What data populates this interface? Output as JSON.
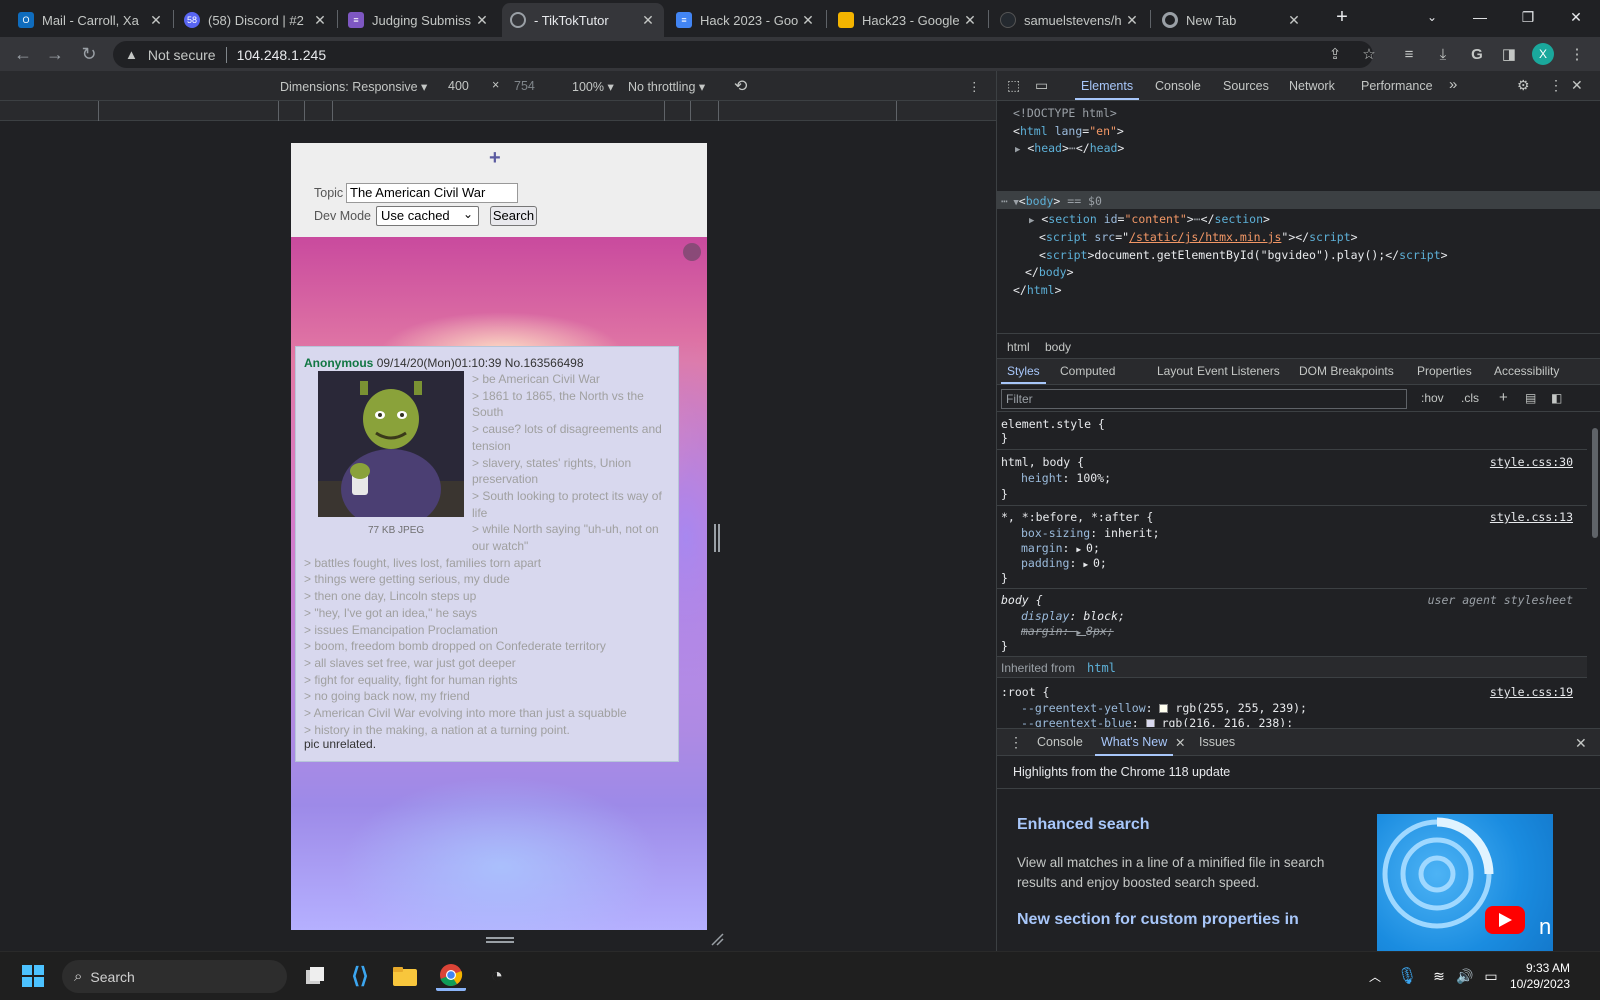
{
  "browser": {
    "tabs": [
      {
        "title": "Mail - Carroll, Xa",
        "color": "#0f6cbd",
        "icon": "outlook-icon"
      },
      {
        "title": "(58) Discord | #2",
        "color": "#5865f2",
        "icon": "discord-icon"
      },
      {
        "title": "Judging Submiss",
        "color": "#7e57c2",
        "icon": "forms-icon"
      },
      {
        "title": "- TikTokTutor",
        "color": "#9aa0a6",
        "icon": "globe-icon"
      },
      {
        "title": "Hack 2023 - Goo",
        "color": "#4285f4",
        "icon": "google-docs-icon"
      },
      {
        "title": "Hack23 - Google",
        "color": "#f4b400",
        "icon": "google-slides-icon"
      },
      {
        "title": "samuelstevens/h",
        "color": "#24292f",
        "icon": "github-icon"
      },
      {
        "title": "New Tab",
        "color": "#9aa0a6",
        "icon": "chrome-icon"
      }
    ],
    "security_label": "Not secure",
    "url": "104.248.1.245",
    "profile_initial": "X"
  },
  "device_toolbar": {
    "dimensions": "Dimensions: Responsive",
    "width": "400",
    "times": "×",
    "height": "754",
    "zoom": "100%",
    "throttling": "No throttling"
  },
  "page": {
    "plus": "+",
    "topic_label": "Topic",
    "topic_value": "The American Civil War",
    "devmode_label": "Dev Mode",
    "devmode_value": "Use cached",
    "search_label": "Search",
    "post": {
      "name": "Anonymous",
      "datetime": "09/14/20(Mon)01:10:39 No.163566498",
      "file_info": "77 KB JPEG",
      "lines_beside": [
        "> be American Civil War",
        "> 1861 to 1865, the North vs the",
        "South",
        "> cause? lots of disagreements and",
        "tension",
        "> slavery, states' rights, Union",
        "preservation",
        "> South looking to protect its way of",
        "life",
        "> while North saying \"uh-uh, not on",
        "our watch\""
      ],
      "lines_full": [
        "> battles fought, lives lost, families torn apart",
        "> things were getting serious, my dude",
        "> then one day, Lincoln steps up",
        "> \"hey, I've got an idea,\" he says",
        "> issues Emancipation Proclamation",
        "> boom, freedom bomb dropped on Confederate territory",
        "> all slaves set free, war just got deeper",
        "> fight for equality, fight for human rights",
        "> no going back now, my friend",
        "> American Civil War evolving into more than just a squabble",
        "> history in the making, a nation at a turning point."
      ],
      "ending": "pic unrelated."
    }
  },
  "devtools": {
    "tabs": [
      "Elements",
      "Console",
      "Sources",
      "Network",
      "Performance"
    ],
    "more": "»",
    "dom": {
      "doctype": "<!DOCTYPE html>",
      "html_open": "html",
      "lang_attr": "lang",
      "lang_val": "\"en\"",
      "head": "head",
      "body": "body",
      "body_marker": "== $0",
      "section": "section",
      "id_attr": "id",
      "id_val": "\"content\"",
      "script": "script",
      "src_attr": "src",
      "src_val": "/static/js/htmx.min.js",
      "inline_script": "document.getElementById(\"bgvideo\").play();",
      "ellipsis": "⋯"
    },
    "breadcrumb": [
      "html",
      "body"
    ],
    "style_tabs": [
      "Styles",
      "Computed",
      "Layout",
      "Event Listeners",
      "DOM Breakpoints",
      "Properties",
      "Accessibility"
    ],
    "filter_placeholder": "Filter",
    "hov": ":hov",
    "cls": ".cls",
    "rules": {
      "element_style": "element.style {",
      "r1_sel": "html, body {",
      "r1_src": "style.css:30",
      "r1_p1": "height",
      "r1_v1": "100%;",
      "r2_sel": "*, *:before, *:after {",
      "r2_src": "style.css:13",
      "r2_p1": "box-sizing",
      "r2_v1": "inherit;",
      "r2_p2": "margin",
      "r2_v2": "0;",
      "r2_p3": "padding",
      "r2_v3": "0;",
      "r3_sel": "body {",
      "r3_src": "user agent stylesheet",
      "r3_p1": "display",
      "r3_v1": "block;",
      "r3_p2": "margin",
      "r3_v2": "8px;",
      "inherited_label": "Inherited from",
      "inherited_tag": "html",
      "r4_sel": ":root {",
      "r4_src": "style.css:19",
      "r4_p1": "--greentext-yellow",
      "r4_v1": "rgb(255, 255, 239);",
      "r4_p2": "--greentext-blue",
      "r4_v2": "rgb(216, 216, 238);",
      "close_brace": "}"
    },
    "drawer_tabs": [
      "Console",
      "What's New",
      "Issues"
    ],
    "whats_new": {
      "highlight": "Highlights from the Chrome 118 update",
      "h1": "Enhanced search",
      "d1": "View all matches in a line of a minified file in search results and enjoy boosted search speed.",
      "h2": "New section for custom properties in"
    }
  },
  "taskbar": {
    "search_label": "Search",
    "time": "9:33 AM",
    "date": "10/29/2023"
  }
}
